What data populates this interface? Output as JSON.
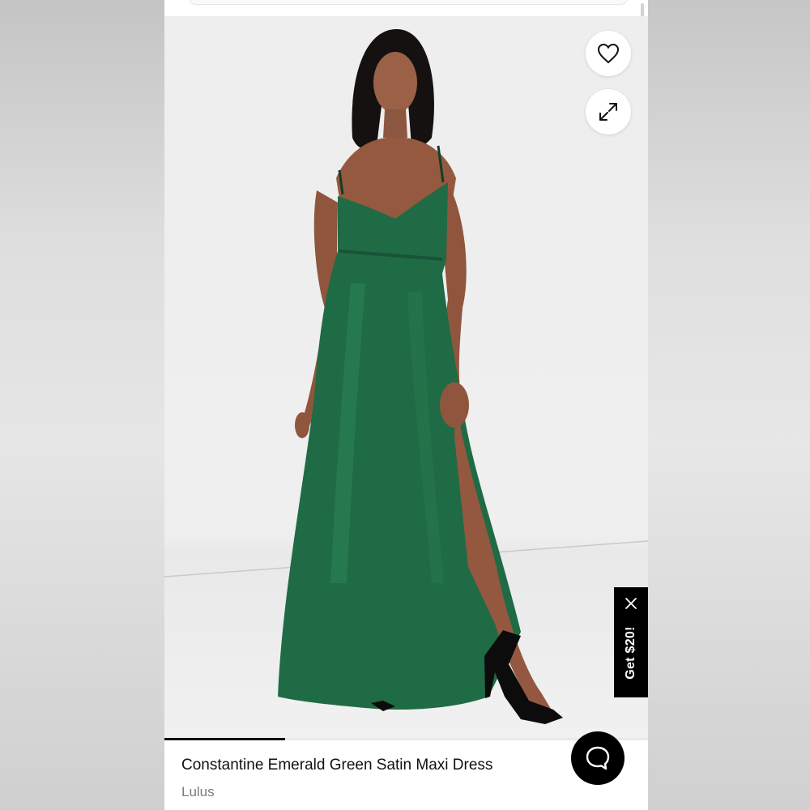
{
  "product": {
    "title": "Constantine Emerald Green Satin Maxi Dress",
    "brand": "Lulus"
  },
  "promo": {
    "label": "Get $20!"
  },
  "gallery": {
    "progress": 0.25
  },
  "icons": {
    "favorite": "heart-icon",
    "expand": "expand-icon",
    "close": "close-icon",
    "chat": "chat-bubble-icon"
  },
  "colors": {
    "dress": "#1f6b45",
    "promo_bg": "#000000",
    "chat_bg": "#000000"
  }
}
